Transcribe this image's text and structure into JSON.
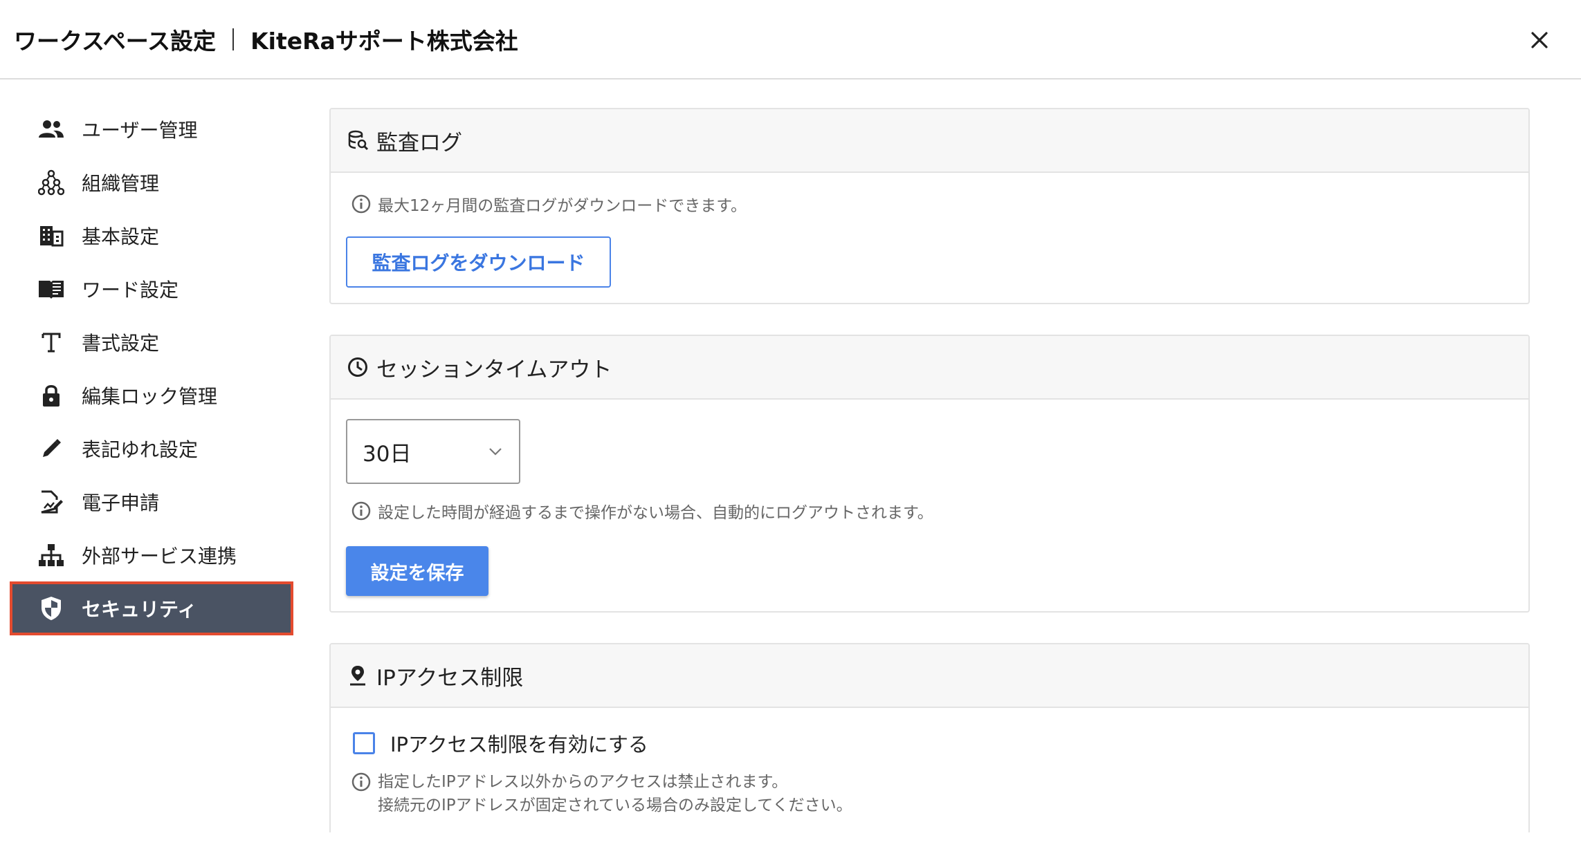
{
  "header": {
    "title": "ワークスペース設定",
    "workspace": "KiteRaサポート株式会社"
  },
  "sidebar": {
    "items": [
      {
        "label": "ユーザー管理",
        "icon": "users-icon"
      },
      {
        "label": "組織管理",
        "icon": "org-chart-icon"
      },
      {
        "label": "基本設定",
        "icon": "building-icon"
      },
      {
        "label": "ワード設定",
        "icon": "book-icon"
      },
      {
        "label": "書式設定",
        "icon": "text-format-icon"
      },
      {
        "label": "編集ロック管理",
        "icon": "lock-icon"
      },
      {
        "label": "表記ゆれ設定",
        "icon": "pencil-icon"
      },
      {
        "label": "電子申請",
        "icon": "document-sign-icon"
      },
      {
        "label": "外部サービス連携",
        "icon": "hierarchy-icon"
      },
      {
        "label": "セキュリティ",
        "icon": "shield-icon",
        "active": true
      }
    ]
  },
  "audit_log": {
    "title": "監査ログ",
    "info": "最大12ヶ月間の監査ログがダウンロードできます。",
    "button": "監査ログをダウンロード"
  },
  "session": {
    "title": "セッションタイムアウト",
    "selected": "30日",
    "info": "設定した時間が経過するまで操作がない場合、自動的にログアウトされます。",
    "save_button": "設定を保存"
  },
  "ip": {
    "title": "IPアクセス制限",
    "checkbox_label": "IPアクセス制限を有効にする",
    "info_line1": "指定したIPアドレス以外からのアクセスは禁止されます。",
    "info_line2": "接続元のIPアドレスが固定されている場合のみ設定してください。"
  },
  "colors": {
    "accent": "#4a86ea",
    "active_nav_bg": "#4a5363",
    "active_nav_outline": "#e34b2f"
  }
}
